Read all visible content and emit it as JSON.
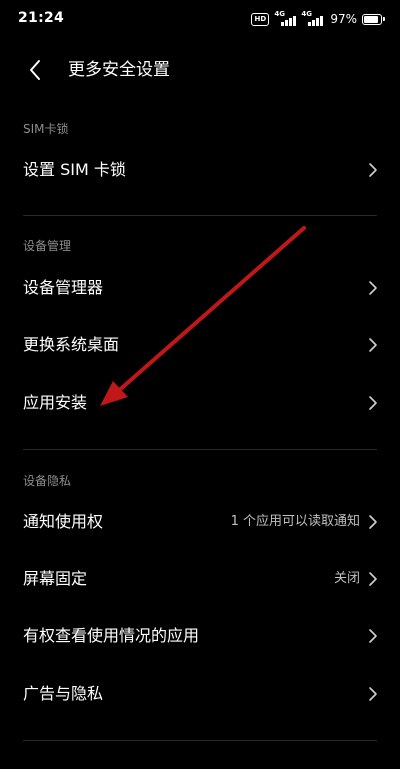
{
  "status_bar": {
    "time": "21:24",
    "hd_label": "HD",
    "sim1_network": "4G",
    "sim2_network": "4G",
    "battery_percent": "97%"
  },
  "header": {
    "title": "更多安全设置",
    "back_icon": "chevron-left-icon"
  },
  "sections": [
    {
      "header": "SIM卡锁",
      "items": [
        {
          "label": "设置 SIM 卡锁",
          "value": ""
        }
      ]
    },
    {
      "header": "设备管理",
      "items": [
        {
          "label": "设备管理器",
          "value": ""
        },
        {
          "label": "更换系统桌面",
          "value": ""
        },
        {
          "label": "应用安装",
          "value": ""
        }
      ]
    },
    {
      "header": "设备隐私",
      "items": [
        {
          "label": "通知使用权",
          "value": "1 个应用可以读取通知"
        },
        {
          "label": "屏幕固定",
          "value": "关闭"
        },
        {
          "label": "有权查看使用情况的应用",
          "value": ""
        },
        {
          "label": "广告与隐私",
          "value": ""
        }
      ]
    }
  ],
  "annotation": {
    "color": "#c01818",
    "icon": "arrow-icon"
  },
  "colors": {
    "background": "#000000",
    "text": "#ffffff",
    "secondary_text": "#8c8c8c",
    "value_text": "#bfbfbf",
    "divider": "#2a2a2a"
  }
}
